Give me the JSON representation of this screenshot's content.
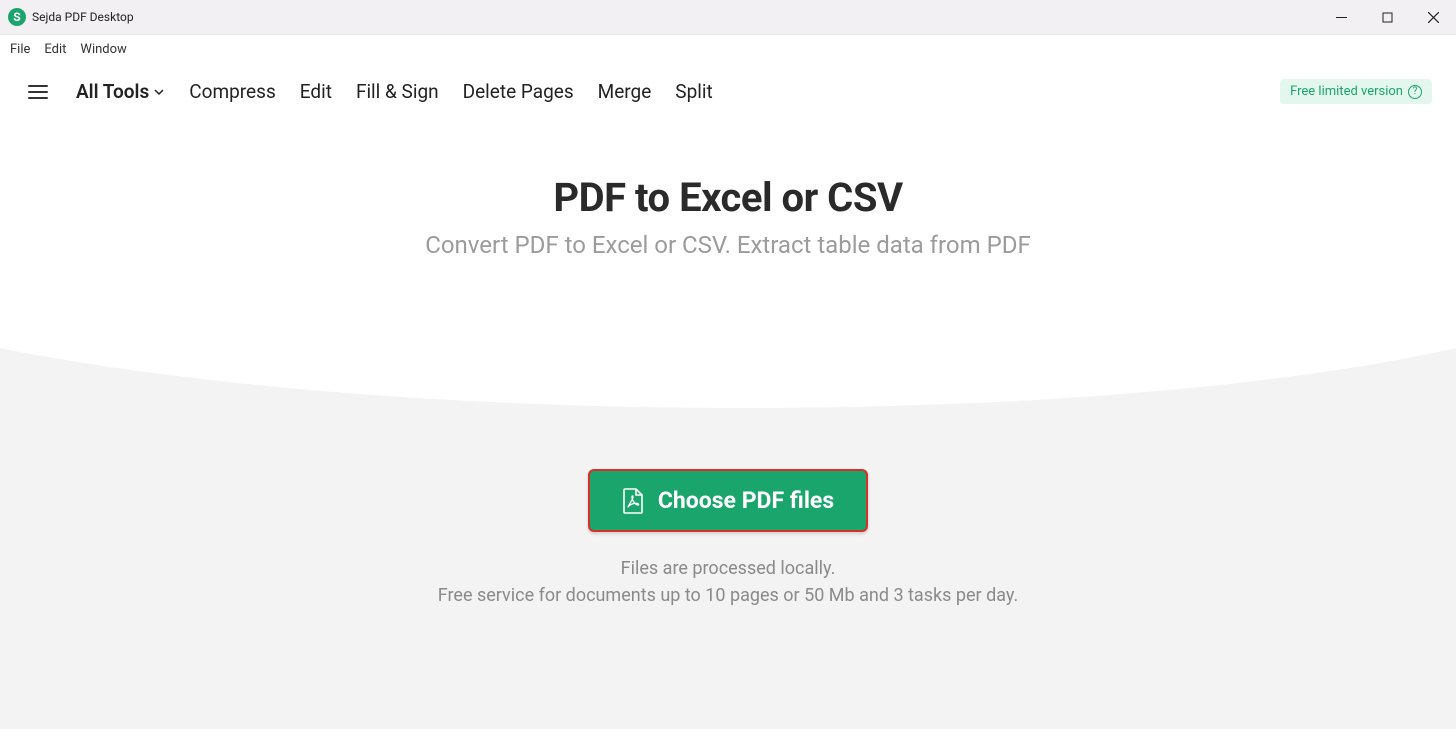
{
  "window": {
    "title": "Sejda PDF Desktop",
    "logo_letter": "S"
  },
  "menubar": {
    "file": "File",
    "edit": "Edit",
    "window": "Window"
  },
  "toolbar": {
    "all_tools": "All Tools",
    "compress": "Compress",
    "edit": "Edit",
    "fill_sign": "Fill & Sign",
    "delete_pages": "Delete Pages",
    "merge": "Merge",
    "split": "Split",
    "version_badge": "Free limited version",
    "help_glyph": "?"
  },
  "main": {
    "title": "PDF to Excel or CSV",
    "subtitle": "Convert PDF to Excel or CSV. Extract table data from PDF",
    "choose_label": "Choose PDF files",
    "info1": "Files are processed locally.",
    "info2": "Free service for documents up to 10 pages or 50 Mb and 3 tasks per day."
  }
}
